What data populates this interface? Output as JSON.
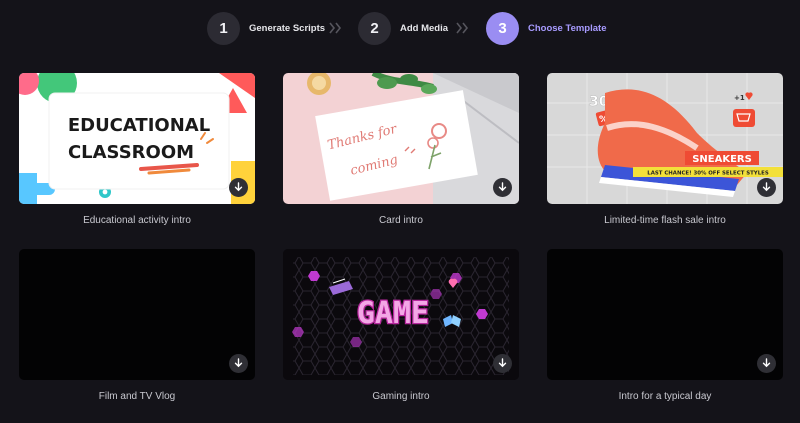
{
  "stepper": {
    "steps": [
      {
        "number": "1",
        "label": "Generate Scripts",
        "active": false
      },
      {
        "number": "2",
        "label": "Add Media",
        "active": false
      },
      {
        "number": "3",
        "label": "Choose Template",
        "active": true
      }
    ]
  },
  "colors": {
    "background": "#141319",
    "accent": "#9a8df2",
    "accent_text": "#a89bff",
    "inactive_step": "#2c2b33"
  },
  "templates": [
    {
      "title": "Educational activity intro",
      "art_text": [
        "EDUCATIONAL",
        "CLASSROOM"
      ],
      "icon": "download-icon"
    },
    {
      "title": "Card intro",
      "art_text": [
        "Thanks for",
        "coming"
      ],
      "icon": "download-icon"
    },
    {
      "title": "Limited-time flash sale intro",
      "art_text": [
        "30",
        "%",
        "SNEAKERS",
        "LAST CHANCE!  30% OFF SELECT STYLES",
        "+1"
      ],
      "icon": "download-icon"
    },
    {
      "title": "Film and TV Vlog",
      "art_text": [],
      "icon": "download-icon"
    },
    {
      "title": "Gaming intro",
      "art_text": [
        "GAME"
      ],
      "icon": "download-icon"
    },
    {
      "title": "Intro for a typical day",
      "art_text": [],
      "icon": "download-icon"
    }
  ]
}
